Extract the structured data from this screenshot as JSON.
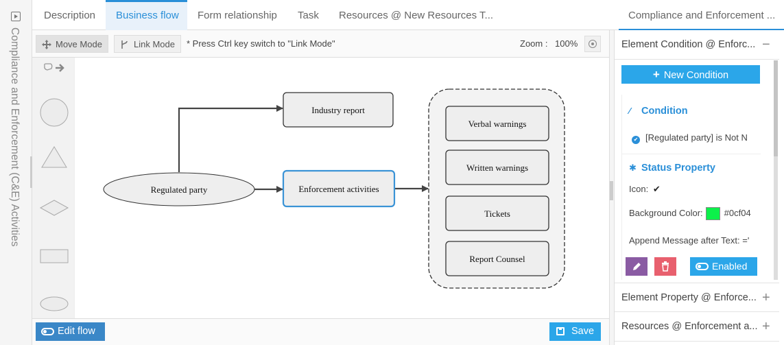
{
  "sidebar": {
    "title": "Compliance and Enforcement (C&E) Activities"
  },
  "tabs": [
    {
      "label": "Description"
    },
    {
      "label": "Business flow",
      "active": true
    },
    {
      "label": "Form relationship"
    },
    {
      "label": "Task"
    },
    {
      "label": "Resources @ New Resources T..."
    },
    {
      "label": "Compliance and Enforcement ..."
    }
  ],
  "toolbar": {
    "move_mode": "Move Mode",
    "link_mode": "Link Mode",
    "hint": "* Press Ctrl key switch to \"Link Mode\"",
    "zoom_label": "Zoom :",
    "zoom_value": "100%"
  },
  "diagram": {
    "nodes": {
      "regulated_party": "Regulated party",
      "industry_report": "Industry report",
      "enforcement_activities": "Enforcement activities",
      "verbal_warnings": "Verbal warnings",
      "written_warnings": "Written warnings",
      "tickets": "Tickets",
      "report_counsel": "Report Counsel"
    }
  },
  "bottombar": {
    "edit_flow": "Edit flow",
    "save": "Save"
  },
  "rightpanel": {
    "section1": "Element Condition @ Enforc...",
    "new_condition": "New Condition",
    "condition_title": "Condition",
    "condition_text": "[Regulated party] is Not N",
    "status_title": "Status Property",
    "icon_label": "Icon:",
    "icon_value": "✔",
    "bg_label": "Background Color:",
    "bg_value": "#0cf04",
    "bg_color": "#0cf04a",
    "append_label": "Append Message after Text: ='",
    "enabled": "Enabled",
    "section2": "Element Property @ Enforce...",
    "section3": "Resources @ Enforcement a..."
  },
  "colors": {
    "accent": "#2a8fd8",
    "button": "#2ba6e9",
    "edit_flow": "#3a87c7",
    "edit": "#8a5ba3",
    "delete": "#e8606e"
  }
}
